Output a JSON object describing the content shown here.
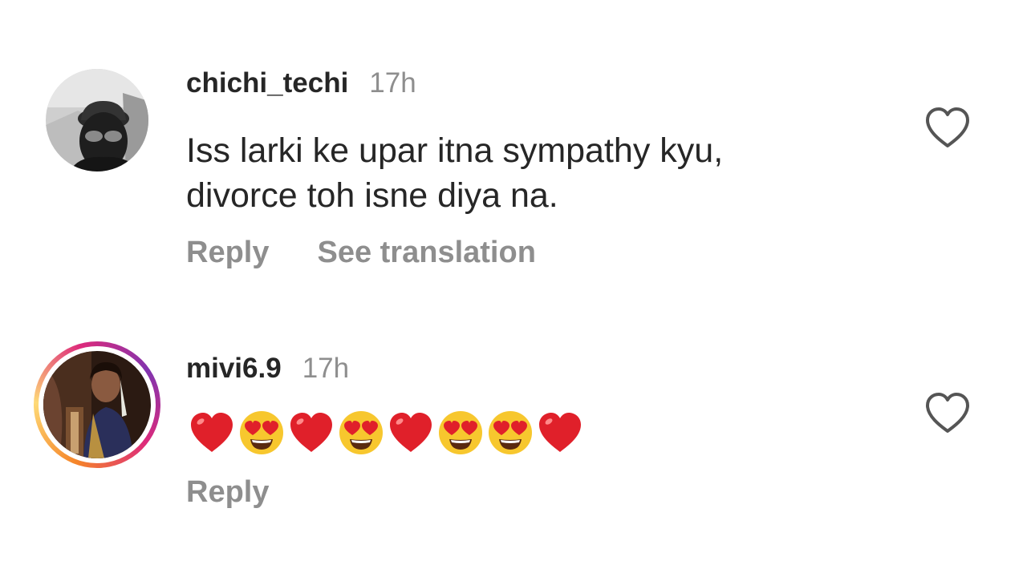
{
  "comments": [
    {
      "username": "chichi_techi",
      "time": "17h",
      "text_lines": [
        "Iss larki ke upar itna sympathy kyu,",
        "divorce toh isne diya na."
      ],
      "actions": [
        "Reply",
        "See translation"
      ],
      "avatar_icon": "masked-person-avatar",
      "like_icon": "heart-outline-icon"
    },
    {
      "username": "mivi6.9",
      "time": "17h",
      "emojis": [
        "red-heart",
        "heart-eyes",
        "red-heart",
        "heart-eyes",
        "red-heart",
        "heart-eyes",
        "heart-eyes",
        "red-heart"
      ],
      "actions": [
        "Reply"
      ],
      "avatar_icon": "woman-portrait-avatar",
      "story_ring": true,
      "like_icon": "heart-outline-icon"
    }
  ],
  "colors": {
    "username": "#262626",
    "secondary": "#8e8e8e",
    "heart_red": "#e0202a",
    "emoji_yellow": "#f7c72e"
  }
}
